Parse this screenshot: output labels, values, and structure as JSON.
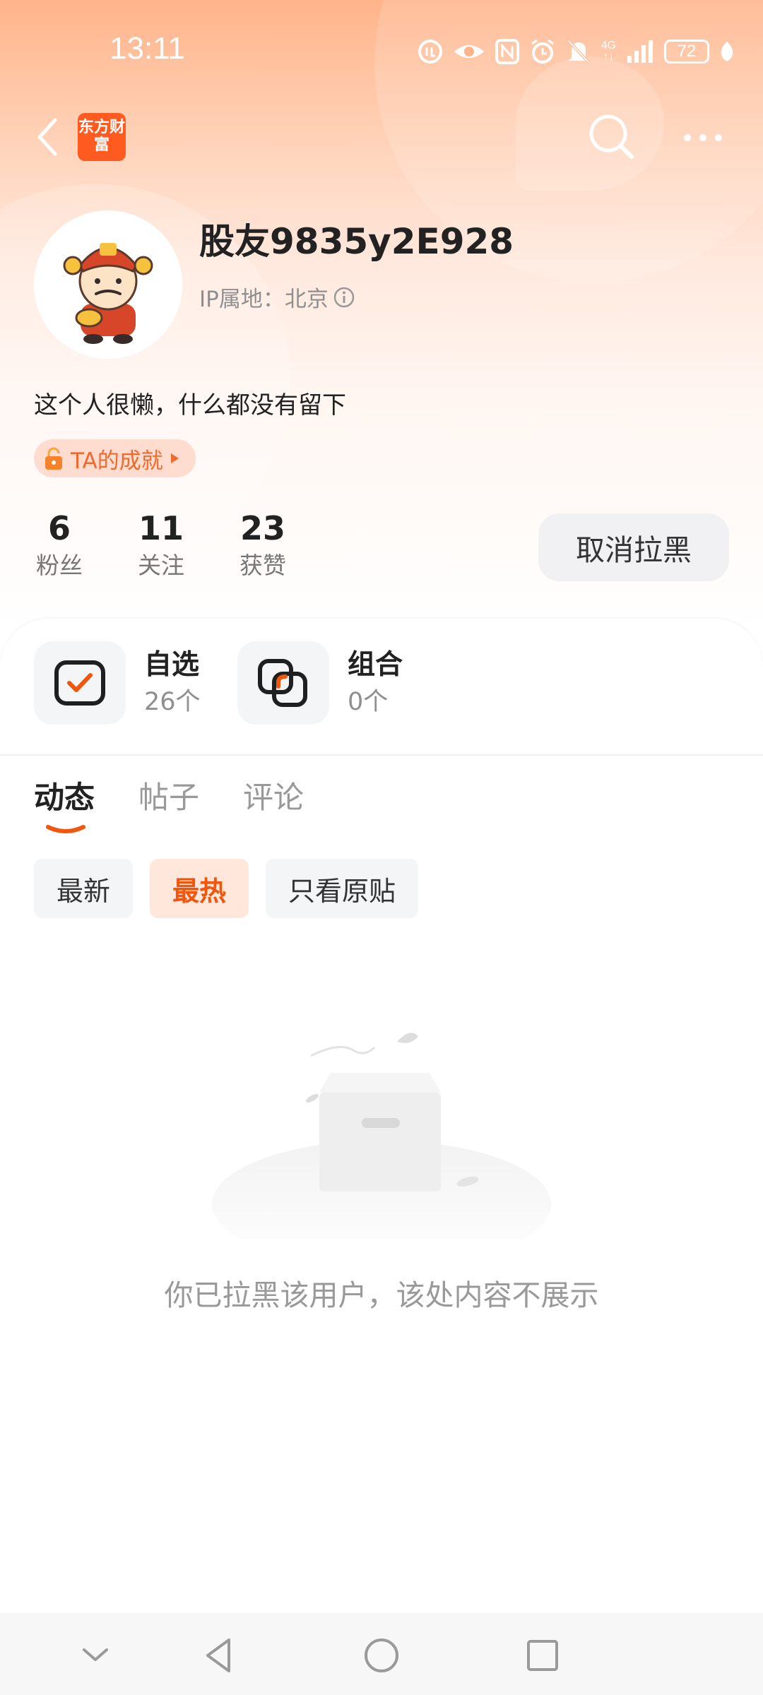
{
  "status_bar": {
    "time": "13:11",
    "network_label": "4G",
    "battery": "72"
  },
  "header": {
    "back_icon": "chevron-left-icon",
    "app_logo_text": "东方财富",
    "search_icon": "search-icon",
    "more_icon": "more-horizontal-icon"
  },
  "profile": {
    "username": "股友9835y2E928",
    "ip_location": "IP属地：北京",
    "bio": "这个人很懒，什么都没有留下",
    "achievement_label": "TA的成就",
    "stats": [
      {
        "value": "6",
        "label": "粉丝"
      },
      {
        "value": "11",
        "label": "关注"
      },
      {
        "value": "23",
        "label": "获赞"
      }
    ],
    "unblock_button": "取消拉黑"
  },
  "portfolio": [
    {
      "title": "自选",
      "count": "26个",
      "icon": "checkbox-icon"
    },
    {
      "title": "组合",
      "count": "0个",
      "icon": "stacked-squares-icon"
    }
  ],
  "tabs": [
    {
      "label": "动态",
      "active": true
    },
    {
      "label": "帖子",
      "active": false
    },
    {
      "label": "评论",
      "active": false
    }
  ],
  "filters": [
    {
      "label": "最新",
      "active": false
    },
    {
      "label": "最热",
      "active": true
    },
    {
      "label": "只看原贴",
      "active": false
    }
  ],
  "empty_state": {
    "message": "你已拉黑该用户，该处内容不展示"
  },
  "colors": {
    "accent": "#f0560e",
    "brand": "#ff5a1f",
    "header_gradient_top": "#ffb48a"
  }
}
